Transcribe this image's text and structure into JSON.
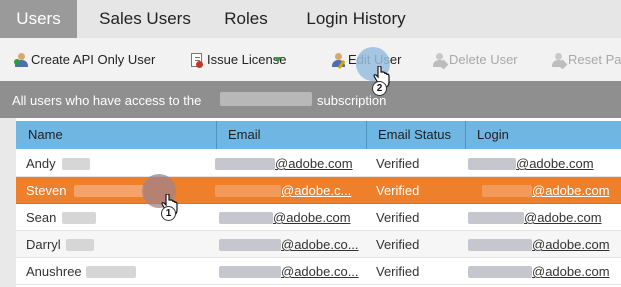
{
  "tabs": [
    {
      "label": "Users",
      "active": true
    },
    {
      "label": "Sales Users",
      "active": false
    },
    {
      "label": "Roles",
      "active": false
    },
    {
      "label": "Login History",
      "active": false
    }
  ],
  "toolbar": {
    "create_api_user": "Create API Only User",
    "issue_license": "Issue License",
    "edit_user": "Edit User",
    "delete_user": "Delete User",
    "reset_password": "Reset Pa"
  },
  "banner": {
    "prefix": "All users who have access to the",
    "suffix": "subscription"
  },
  "table": {
    "columns": [
      "Name",
      "Email",
      "Email Status",
      "Login"
    ],
    "rows": [
      {
        "name": "Andy",
        "email": "@adobe.com",
        "status": "Verified",
        "login": "@adobe.com"
      },
      {
        "name": "Steven",
        "email": "@adobe.c...",
        "status": "Verified",
        "login": "@adobe.com"
      },
      {
        "name": "Sean",
        "email": "@adobe.com",
        "status": "Verified",
        "login": "@adobe.com"
      },
      {
        "name": "Darryl",
        "email": "@adobe.co...",
        "status": "Verified",
        "login": "@adobe.com"
      },
      {
        "name": "Anushree",
        "email": "@adobe.co...",
        "status": "Verified",
        "login": "@adobe.com"
      }
    ]
  },
  "callouts": {
    "one": "1",
    "two": "2"
  },
  "colors": {
    "tab_active": "#9a9a9a",
    "header_blue": "#70b6e2",
    "selected_row": "#ee7f2b",
    "banner_grey": "#8f8f8f"
  }
}
